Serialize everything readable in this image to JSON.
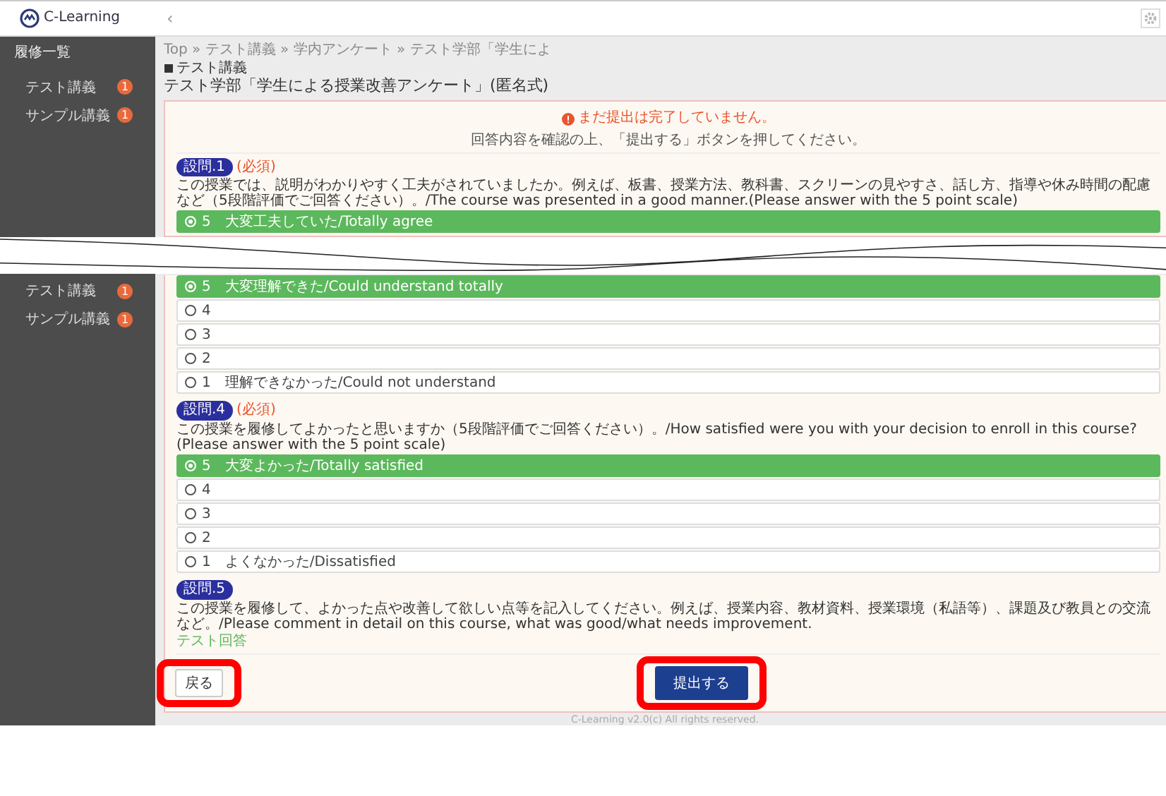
{
  "top_screen": {
    "header": {
      "logo": "C-Learning",
      "collapse": "‹"
    },
    "sidebar": {
      "heading": "履修一覧",
      "items": [
        {
          "label": "テスト講義",
          "badge": "1"
        },
        {
          "label": "サンプル講義",
          "badge": "1"
        }
      ]
    },
    "breadcrumb": "Top » テスト講義 » 学内アンケート » テスト学部「学生によ",
    "course": "テスト講義",
    "title": "テスト学部「学生による授業改善アンケート」(匿名式)",
    "alert": {
      "title": "まだ提出は完了していません。",
      "message": "回答内容を確認の上、「提出する」ボタンを押してください。"
    },
    "questions": [
      {
        "number": "設問.1",
        "required": "(必須)",
        "text": "この授業では、説明がわかりやすく工夫がされていましたか。例えば、板書、授業方法、教科書、スクリーンの見やすさ、話し方、指導や休み時間の配慮など（5段階評価でご回答ください）。/The course was presented in a good manner.(Please answer with the 5 point scale)",
        "options": [
          {
            "label": "5　大変工夫していた/Totally agree",
            "selected": true
          }
        ]
      }
    ]
  },
  "bottom_screen": {
    "sidebar": {
      "items": [
        {
          "label": "テスト講義",
          "badge": "1"
        },
        {
          "label": "サンプル講義",
          "badge": "1"
        }
      ]
    },
    "questions": [
      {
        "options": [
          {
            "label": "5　大変理解できた/Could understand totally",
            "selected": true
          },
          {
            "label": "4",
            "selected": false
          },
          {
            "label": "3",
            "selected": false
          },
          {
            "label": "2",
            "selected": false
          },
          {
            "label": "1　理解できなかった/Could not understand",
            "selected": false
          }
        ]
      },
      {
        "number": "設問.4",
        "required": "(必須)",
        "text": "この授業を履修してよかったと思いますか（5段階評価でご回答ください）。/How satisfied were you with your decision to enroll in this course? (Please answer with the 5 point scale)",
        "options": [
          {
            "label": "5　大変よかった/Totally satisfied",
            "selected": true
          },
          {
            "label": "4",
            "selected": false
          },
          {
            "label": "3",
            "selected": false
          },
          {
            "label": "2",
            "selected": false
          },
          {
            "label": "1　よくなかった/Dissatisfied",
            "selected": false
          }
        ]
      },
      {
        "number": "設問.5",
        "text": "この授業を履修して、よかった点や改善して欲しい点等を記入してください。例えば、授業内容、教材資料、授業環境（私語等）、課題及び教員との交流など。/Please comment in detail on this course, what was good/what needs improvement.",
        "answer": "テスト回答"
      }
    ],
    "buttons": [
      {
        "label": "戻る",
        "kind": "back",
        "highlighted": true
      },
      {
        "label": "提出する",
        "kind": "submit",
        "highlighted": true
      }
    ],
    "footer": "C-Learning v2.0(c) All rights reserved."
  }
}
